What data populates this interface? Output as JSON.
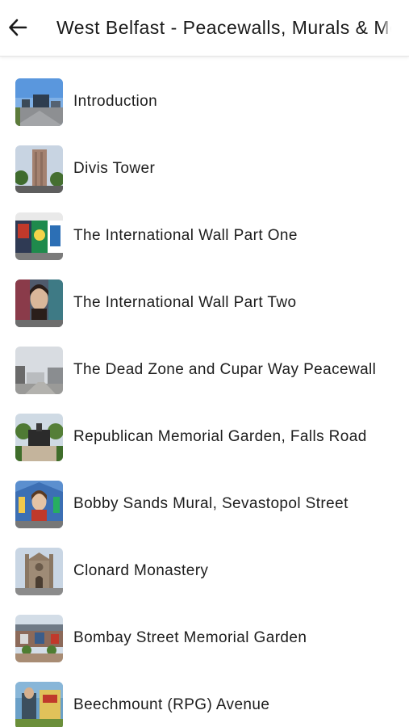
{
  "header": {
    "back_icon": "arrow-left-icon",
    "title": "West Belfast - Peacewalls, Murals & Memorials"
  },
  "stops": [
    {
      "label": "Introduction",
      "thumb": "street-photo-thumbnail"
    },
    {
      "label": "Divis Tower",
      "thumb": "tower-photo-thumbnail"
    },
    {
      "label": "The International Wall Part One",
      "thumb": "mural-wall-photo-thumbnail"
    },
    {
      "label": "The International Wall Part Two",
      "thumb": "portrait-mural-photo-thumbnail"
    },
    {
      "label": "The Dead Zone and Cupar Way Peacewall",
      "thumb": "peacewall-photo-thumbnail"
    },
    {
      "label": "Republican Memorial Garden, Falls Road",
      "thumb": "memorial-garden-photo-thumbnail"
    },
    {
      "label": "Bobby Sands Mural, Sevastopol Street",
      "thumb": "bobby-sands-mural-photo-thumbnail"
    },
    {
      "label": "Clonard Monastery",
      "thumb": "monastery-photo-thumbnail"
    },
    {
      "label": "Bombay Street Memorial Garden",
      "thumb": "bombay-street-garden-photo-thumbnail"
    },
    {
      "label": "Beechmount (RPG) Avenue",
      "thumb": "beechmount-mural-photo-thumbnail"
    }
  ]
}
